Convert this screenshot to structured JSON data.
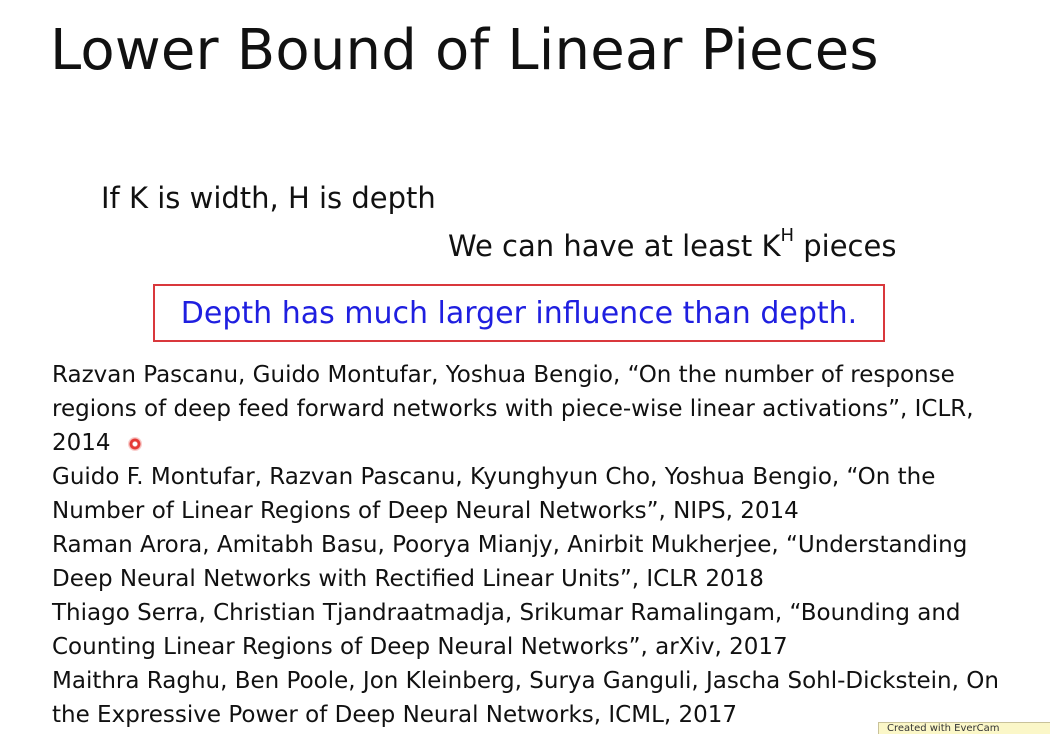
{
  "slide": {
    "title": "Lower Bound of Linear Pieces",
    "line1": "If K is width, H is depth",
    "line2_prefix": "We can have at least K",
    "line2_superscript": "H",
    "line2_suffix": " pieces",
    "highlight": "Depth has much larger influence than depth.",
    "highlight_color": "#1f1fe0",
    "box_color": "#d9383c"
  },
  "references": [
    "Razvan Pascanu, Guido Montufar, Yoshua Bengio, “On the number of response regions of deep feed forward networks with piece-wise linear activations”, ICLR, 2014",
    "Guido F. Montufar, Razvan Pascanu, Kyunghyun Cho, Yoshua Bengio, “On the Number of Linear Regions of Deep Neural Networks”, NIPS, 2014",
    "Raman Arora, Amitabh Basu, Poorya Mianjy, Anirbit Mukherjee, “Understanding Deep Neural Networks with Rectified Linear Units”, ICLR 2018",
    "Thiago Serra, Christian Tjandraatmadja, Srikumar Ramalingam, “Bounding and Counting Linear Regions of Deep Neural Networks”, arXiv, 2017",
    "Maithra Raghu, Ben Poole, Jon Kleinberg, Surya Ganguli, Jascha Sohl-Dickstein, On the Expressive Power of Deep Neural Networks, ICML, 2017"
  ],
  "watermark": "Created with EverCam"
}
